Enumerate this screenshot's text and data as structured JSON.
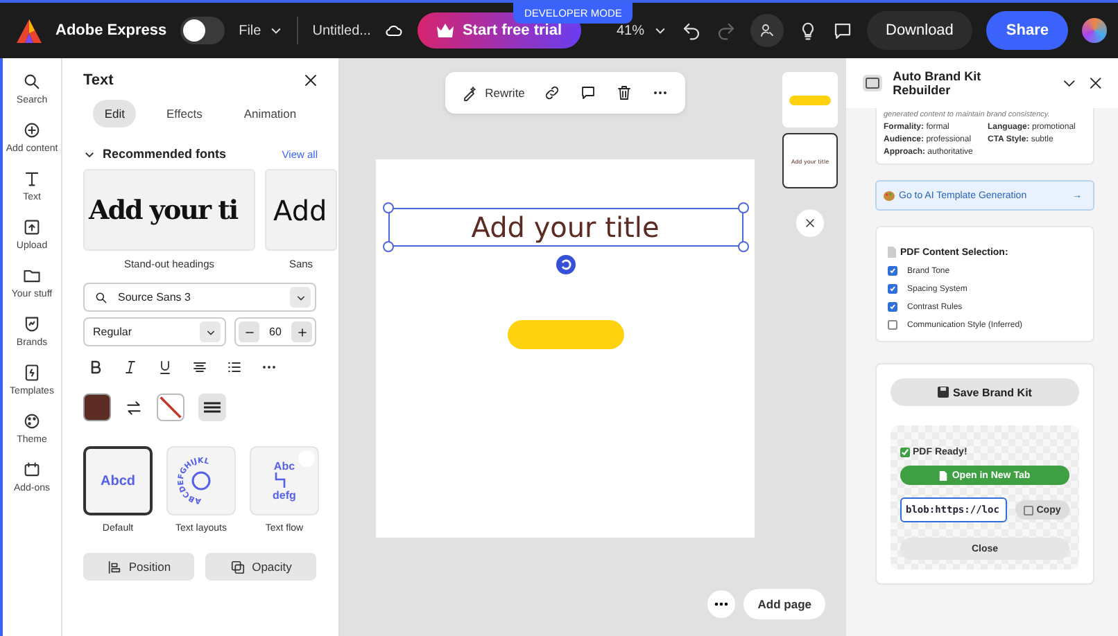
{
  "topbar": {
    "app_name": "Adobe Express",
    "file_menu": "File",
    "toggle": {
      "on": false
    },
    "doc_title": "Untitled...",
    "trial_button": "Start free trial",
    "dev_badge": "DEVELOPER MODE",
    "zoom": "41%",
    "download": "Download",
    "share": "Share"
  },
  "rail": [
    {
      "label": "Search"
    },
    {
      "label": "Add content"
    },
    {
      "label": "Text"
    },
    {
      "label": "Upload"
    },
    {
      "label": "Your stuff"
    },
    {
      "label": "Brands"
    },
    {
      "label": "Templates"
    },
    {
      "label": "Theme"
    },
    {
      "label": "Add-ons"
    }
  ],
  "text_panel": {
    "title": "Text",
    "tabs": [
      {
        "label": "Edit",
        "selected": true
      },
      {
        "label": "Effects",
        "selected": false
      },
      {
        "label": "Animation",
        "selected": false
      }
    ],
    "section": "Recommended fonts",
    "view_all": "View all",
    "font_cards": [
      {
        "sample": "Add your ti",
        "label": "Stand-out headings",
        "kind": "serif"
      },
      {
        "sample": "Add",
        "label": "Sans",
        "kind": "sans"
      }
    ],
    "font_field": {
      "value": "Source Sans 3"
    },
    "weight": {
      "value": "Regular"
    },
    "size": {
      "value": "60"
    },
    "layouts": [
      {
        "label": "Default",
        "sample": "Abcd",
        "kind": "default",
        "selected": true
      },
      {
        "label": "Text layouts",
        "sample": "ABCDEFGHIJKL",
        "kind": "circle",
        "selected": false
      },
      {
        "label": "Text flow",
        "sample": "Abc",
        "sample_2": "defg",
        "kind": "flow",
        "selected": false
      }
    ],
    "buttons": [
      "Position",
      "Opacity"
    ]
  },
  "canvas": {
    "toolbar": {
      "rewrite": "Rewrite"
    },
    "title": "Add your title",
    "thumbnails": [
      {
        "kind": "shape",
        "selected": false
      },
      {
        "kind": "text",
        "text": "Add your title",
        "selected": true
      }
    ],
    "add_page": "Add page"
  },
  "addon": {
    "title": "Auto Brand Kit Rebuilder",
    "note": "generated content to maintain brand consistency.",
    "attributes": [
      {
        "key": "Formality:",
        "value": "formal"
      },
      {
        "key": "Language:",
        "value": "promotional"
      },
      {
        "key": "Audience:",
        "value": "professional"
      },
      {
        "key": "CTA Style:",
        "value": "subtle"
      },
      {
        "key": "Approach:",
        "value": "authoritative"
      }
    ],
    "link": "Go to AI Template Generation",
    "link_arrow": "→",
    "checklist_title": "PDF Content Selection:",
    "checklist": [
      {
        "label": "Brand Tone",
        "checked": true
      },
      {
        "label": "Spacing System",
        "checked": true
      },
      {
        "label": "Contrast Rules",
        "checked": true
      },
      {
        "label": "Communication Style (Inferred)",
        "checked": false
      }
    ],
    "save_button": "Save Brand Kit",
    "ready": "PDF Ready!",
    "open_button": "Open in New Tab",
    "url": "blob:https://loc",
    "copy_button": "Copy",
    "close_button": "Close"
  }
}
